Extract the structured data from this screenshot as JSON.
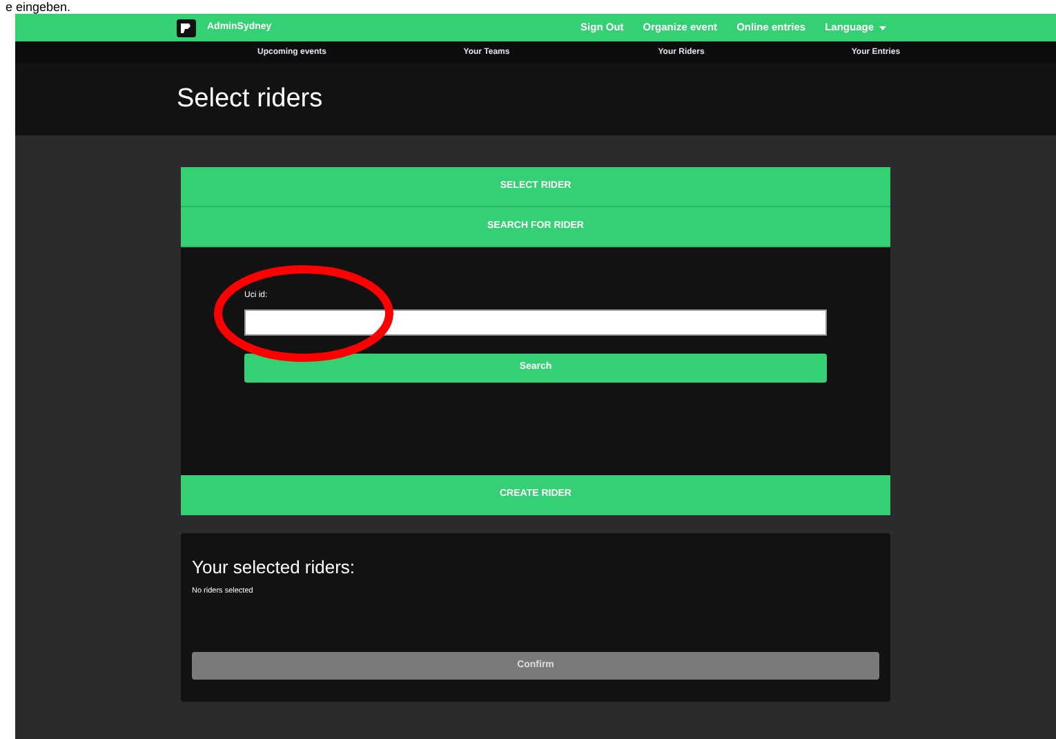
{
  "doc_caption": "e eingeben.",
  "navbar": {
    "brand": "AdminSydney",
    "links": [
      {
        "label": "Sign Out",
        "kind": "link"
      },
      {
        "label": "Organize event",
        "kind": "link"
      },
      {
        "label": "Online entries",
        "kind": "link"
      },
      {
        "label": "Language",
        "kind": "dropdown"
      }
    ]
  },
  "subnav": [
    "Upcoming events",
    "Your Teams",
    "Your Riders",
    "Your Entries"
  ],
  "page_title": "Select riders",
  "rider_panel": {
    "sections": [
      {
        "label": "SELECT RIDER",
        "kind": "header"
      },
      {
        "label": "SEARCH FOR RIDER",
        "kind": "header"
      }
    ],
    "field": {
      "label": "Uci id:",
      "circled": true
    },
    "search_button": "Search",
    "create_button": "CREATE RIDER"
  },
  "selected_panel": {
    "title": "Your selected riders:",
    "empty_text": "No riders selected",
    "confirm_button": "Confirm",
    "confirm_disabled": true
  }
}
